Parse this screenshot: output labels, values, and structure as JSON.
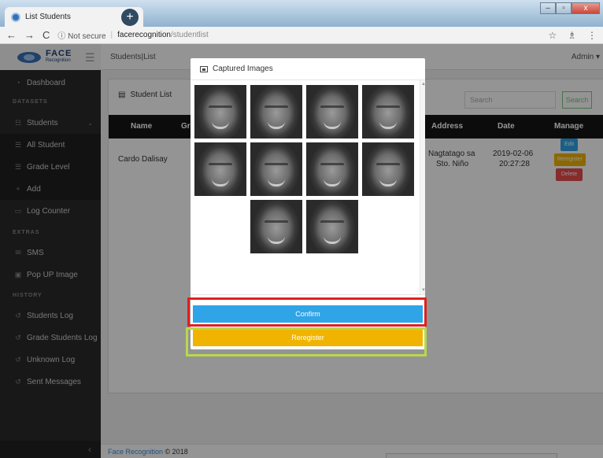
{
  "browser": {
    "tab_title": "List Students",
    "tab_close": "×",
    "new_tab": "+",
    "back": "←",
    "forward": "→",
    "reload": "C",
    "secure_label": "ⓘ Not secure",
    "url_separator": "|",
    "url_host": "facerecognition",
    "url_path": "/studentlist",
    "bookmark_icon": "☆",
    "extension_icon": "♗",
    "menu_icon": "⋮"
  },
  "header": {
    "brand_main": "FACE",
    "brand_sub": "Recognition",
    "breadcrumb": "Students|List",
    "user": "Admin ▾"
  },
  "sidebar": {
    "dashboard": "Dashboard",
    "datasets_header": "DATASETS",
    "students": "Students",
    "all_student": "All Student",
    "grade_level": "Grade Level",
    "add": "Add",
    "log_counter": "Log Counter",
    "extras_header": "EXTRAS",
    "sms": "SMS",
    "popup_image": "Pop UP Image",
    "history_header": "HISTORY",
    "students_log": "Students Log",
    "grade_students_log": "Grade Students Log",
    "unknown_log": "Unknown Log",
    "sent_messages": "Sent Messages",
    "collapse": "‹"
  },
  "main": {
    "card_title": "Student List",
    "search_placeholder": "Search",
    "search_button": "Search",
    "columns": {
      "name": "Name",
      "grade": "Gr",
      "address": "Address",
      "date": "Date",
      "manage": "Manage"
    },
    "row": {
      "name": "Cardo Dalisay",
      "address_line1": "Nagtatago sa",
      "address_line2": "Sto. Niño",
      "date_line1": "2019-02-06",
      "date_line2": "20:27:28",
      "edit": "Edit",
      "reregister": "Reregister",
      "delete": "Delete"
    }
  },
  "modal": {
    "title": "Captured Images",
    "confirm": "Confirm",
    "reregister": "Reregister"
  },
  "footer": {
    "link": "Face Recognition",
    "copyright": " © 2018"
  },
  "colors": {
    "sidebar_bg": "#2a2a2a",
    "table_header_bg": "#161616",
    "confirm_blue": "#2fa4e7",
    "reregister_yellow": "#f0b400",
    "delete_red": "#e74c4c",
    "highlight_red": "#e02020",
    "highlight_green": "#b8d84a"
  }
}
